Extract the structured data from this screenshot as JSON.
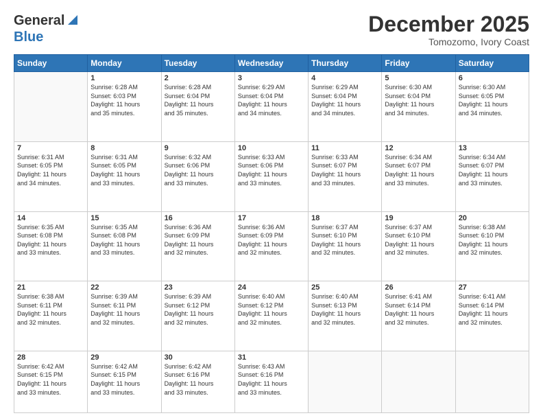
{
  "header": {
    "logo_general": "General",
    "logo_blue": "Blue",
    "month_title": "December 2025",
    "location": "Tomozomo, Ivory Coast"
  },
  "calendar": {
    "days_of_week": [
      "Sunday",
      "Monday",
      "Tuesday",
      "Wednesday",
      "Thursday",
      "Friday",
      "Saturday"
    ],
    "weeks": [
      [
        {
          "day": "",
          "info": ""
        },
        {
          "day": "1",
          "info": "Sunrise: 6:28 AM\nSunset: 6:03 PM\nDaylight: 11 hours\nand 35 minutes."
        },
        {
          "day": "2",
          "info": "Sunrise: 6:28 AM\nSunset: 6:04 PM\nDaylight: 11 hours\nand 35 minutes."
        },
        {
          "day": "3",
          "info": "Sunrise: 6:29 AM\nSunset: 6:04 PM\nDaylight: 11 hours\nand 34 minutes."
        },
        {
          "day": "4",
          "info": "Sunrise: 6:29 AM\nSunset: 6:04 PM\nDaylight: 11 hours\nand 34 minutes."
        },
        {
          "day": "5",
          "info": "Sunrise: 6:30 AM\nSunset: 6:04 PM\nDaylight: 11 hours\nand 34 minutes."
        },
        {
          "day": "6",
          "info": "Sunrise: 6:30 AM\nSunset: 6:05 PM\nDaylight: 11 hours\nand 34 minutes."
        }
      ],
      [
        {
          "day": "7",
          "info": "Sunrise: 6:31 AM\nSunset: 6:05 PM\nDaylight: 11 hours\nand 34 minutes."
        },
        {
          "day": "8",
          "info": "Sunrise: 6:31 AM\nSunset: 6:05 PM\nDaylight: 11 hours\nand 33 minutes."
        },
        {
          "day": "9",
          "info": "Sunrise: 6:32 AM\nSunset: 6:06 PM\nDaylight: 11 hours\nand 33 minutes."
        },
        {
          "day": "10",
          "info": "Sunrise: 6:33 AM\nSunset: 6:06 PM\nDaylight: 11 hours\nand 33 minutes."
        },
        {
          "day": "11",
          "info": "Sunrise: 6:33 AM\nSunset: 6:07 PM\nDaylight: 11 hours\nand 33 minutes."
        },
        {
          "day": "12",
          "info": "Sunrise: 6:34 AM\nSunset: 6:07 PM\nDaylight: 11 hours\nand 33 minutes."
        },
        {
          "day": "13",
          "info": "Sunrise: 6:34 AM\nSunset: 6:07 PM\nDaylight: 11 hours\nand 33 minutes."
        }
      ],
      [
        {
          "day": "14",
          "info": "Sunrise: 6:35 AM\nSunset: 6:08 PM\nDaylight: 11 hours\nand 33 minutes."
        },
        {
          "day": "15",
          "info": "Sunrise: 6:35 AM\nSunset: 6:08 PM\nDaylight: 11 hours\nand 33 minutes."
        },
        {
          "day": "16",
          "info": "Sunrise: 6:36 AM\nSunset: 6:09 PM\nDaylight: 11 hours\nand 32 minutes."
        },
        {
          "day": "17",
          "info": "Sunrise: 6:36 AM\nSunset: 6:09 PM\nDaylight: 11 hours\nand 32 minutes."
        },
        {
          "day": "18",
          "info": "Sunrise: 6:37 AM\nSunset: 6:10 PM\nDaylight: 11 hours\nand 32 minutes."
        },
        {
          "day": "19",
          "info": "Sunrise: 6:37 AM\nSunset: 6:10 PM\nDaylight: 11 hours\nand 32 minutes."
        },
        {
          "day": "20",
          "info": "Sunrise: 6:38 AM\nSunset: 6:10 PM\nDaylight: 11 hours\nand 32 minutes."
        }
      ],
      [
        {
          "day": "21",
          "info": "Sunrise: 6:38 AM\nSunset: 6:11 PM\nDaylight: 11 hours\nand 32 minutes."
        },
        {
          "day": "22",
          "info": "Sunrise: 6:39 AM\nSunset: 6:11 PM\nDaylight: 11 hours\nand 32 minutes."
        },
        {
          "day": "23",
          "info": "Sunrise: 6:39 AM\nSunset: 6:12 PM\nDaylight: 11 hours\nand 32 minutes."
        },
        {
          "day": "24",
          "info": "Sunrise: 6:40 AM\nSunset: 6:12 PM\nDaylight: 11 hours\nand 32 minutes."
        },
        {
          "day": "25",
          "info": "Sunrise: 6:40 AM\nSunset: 6:13 PM\nDaylight: 11 hours\nand 32 minutes."
        },
        {
          "day": "26",
          "info": "Sunrise: 6:41 AM\nSunset: 6:14 PM\nDaylight: 11 hours\nand 32 minutes."
        },
        {
          "day": "27",
          "info": "Sunrise: 6:41 AM\nSunset: 6:14 PM\nDaylight: 11 hours\nand 32 minutes."
        }
      ],
      [
        {
          "day": "28",
          "info": "Sunrise: 6:42 AM\nSunset: 6:15 PM\nDaylight: 11 hours\nand 33 minutes."
        },
        {
          "day": "29",
          "info": "Sunrise: 6:42 AM\nSunset: 6:15 PM\nDaylight: 11 hours\nand 33 minutes."
        },
        {
          "day": "30",
          "info": "Sunrise: 6:42 AM\nSunset: 6:16 PM\nDaylight: 11 hours\nand 33 minutes."
        },
        {
          "day": "31",
          "info": "Sunrise: 6:43 AM\nSunset: 6:16 PM\nDaylight: 11 hours\nand 33 minutes."
        },
        {
          "day": "",
          "info": ""
        },
        {
          "day": "",
          "info": ""
        },
        {
          "day": "",
          "info": ""
        }
      ]
    ]
  }
}
